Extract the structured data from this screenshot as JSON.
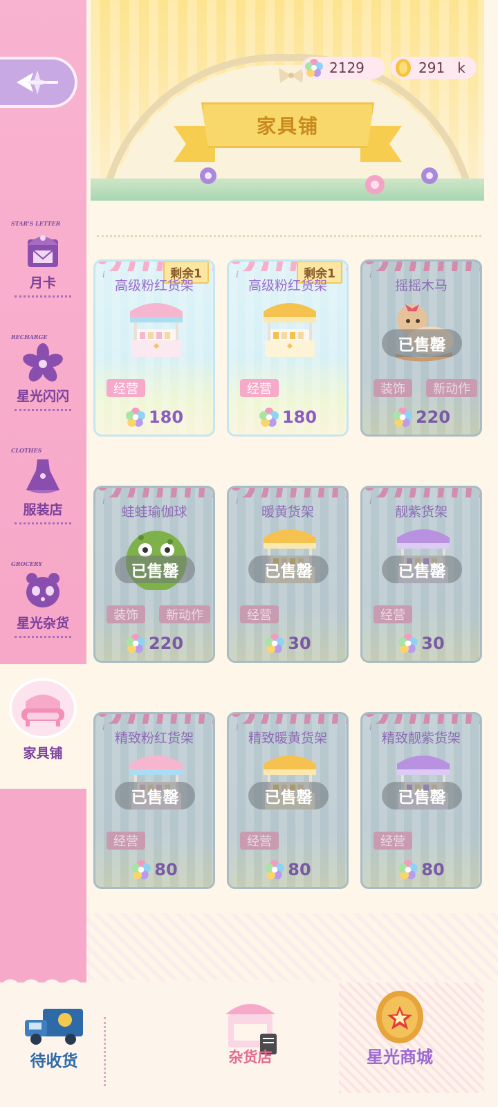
{
  "currency": {
    "stars": "2129",
    "coins": "291",
    "coins_unit": "k"
  },
  "header": {
    "title": "家具铺"
  },
  "sidebar": {
    "items": [
      {
        "tag": "STAR'S LETTER",
        "label": "月卡"
      },
      {
        "tag": "RECHARGE",
        "label": "星光闪闪"
      },
      {
        "tag": "CLOTHES",
        "label": "服装店"
      },
      {
        "tag": "GROCERY",
        "label": "星光杂货"
      }
    ],
    "active": {
      "label": "家具铺"
    }
  },
  "cards": [
    {
      "title": "高级粉红货架",
      "remain": "剩余1",
      "tags": [
        "经营"
      ],
      "price": "180",
      "sold": false,
      "theme": "pink"
    },
    {
      "title": "高级粉红货架",
      "remain": "剩余1",
      "tags": [
        "经营"
      ],
      "price": "180",
      "sold": false,
      "theme": "yellow"
    },
    {
      "title": "摇摇木马",
      "sold_label": "已售罄",
      "tags": [
        "装饰",
        "新动作"
      ],
      "price": "220",
      "sold": true,
      "theme": "horse"
    },
    {
      "title": "蛙蛙瑜伽球",
      "sold_label": "已售罄",
      "tags": [
        "装饰",
        "新动作"
      ],
      "price": "220",
      "sold": true,
      "theme": "frog"
    },
    {
      "title": "暖黄货架",
      "sold_label": "已售罄",
      "tags": [
        "经营"
      ],
      "price": "30",
      "sold": true,
      "theme": "yellow"
    },
    {
      "title": "靓紫货架",
      "sold_label": "已售罄",
      "tags": [
        "经营"
      ],
      "price": "30",
      "sold": true,
      "theme": "purple"
    },
    {
      "title": "精致粉红货架",
      "sold_label": "已售罄",
      "tags": [
        "经营"
      ],
      "price": "80",
      "sold": true,
      "theme": "pink"
    },
    {
      "title": "精致暖黄货架",
      "sold_label": "已售罄",
      "tags": [
        "经营"
      ],
      "price": "80",
      "sold": true,
      "theme": "yellow"
    },
    {
      "title": "精致靓紫货架",
      "sold_label": "已售罄",
      "tags": [
        "经营"
      ],
      "price": "80",
      "sold": true,
      "theme": "purple"
    }
  ],
  "bottom": {
    "delivery": "待收货",
    "grocery": "杂货店",
    "star_mall": "星光商城"
  },
  "colors": {
    "sidebar_pink": "#f7a9c9",
    "accent_purple": "#8b5dc4",
    "banner_yellow": "#fde490"
  }
}
